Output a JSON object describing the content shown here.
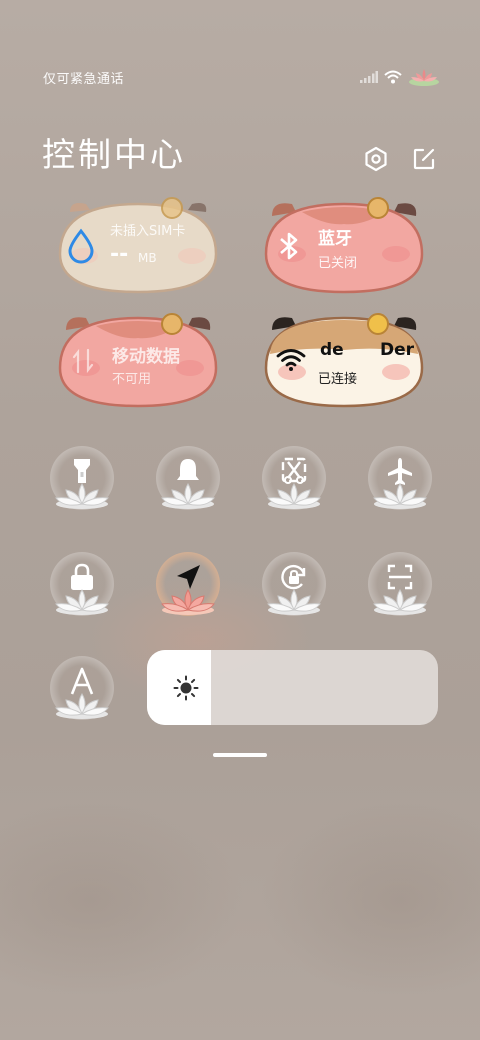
{
  "status": {
    "carrier": "仅可紧急通话"
  },
  "header": {
    "title": "控制中心"
  },
  "tiles": {
    "sim": {
      "name": "未插入SIM卡",
      "value": "--",
      "unit": "MB"
    },
    "bluetooth": {
      "name": "蓝牙",
      "status": "已关闭"
    },
    "mobile_data": {
      "name": "移动数据",
      "status": "不可用"
    },
    "wifi": {
      "name_left": "de",
      "name_right": "Der",
      "status": "已连接"
    }
  },
  "toggles": [
    {
      "id": "flashlight",
      "icon": "flashlight-icon",
      "active": false
    },
    {
      "id": "bell",
      "icon": "bell-icon",
      "active": false
    },
    {
      "id": "screenshot",
      "icon": "scissors-icon",
      "active": false
    },
    {
      "id": "airplane",
      "icon": "airplane-icon",
      "active": false
    },
    {
      "id": "lock",
      "icon": "lock-icon",
      "active": false
    },
    {
      "id": "location",
      "icon": "location-arrow-icon",
      "active": true
    },
    {
      "id": "rotation",
      "icon": "rotation-lock-icon",
      "active": false
    },
    {
      "id": "scan",
      "icon": "scan-icon",
      "active": false
    },
    {
      "id": "font",
      "icon": "font-a-icon",
      "active": false
    }
  ],
  "brightness": {
    "level": 0.22
  },
  "colors": {
    "accent_blue": "#2e8ae6",
    "active_lotus": "#f2a9a0",
    "tile_beige": "#f1e4d0",
    "tile_pink": "#f2a7a1"
  }
}
